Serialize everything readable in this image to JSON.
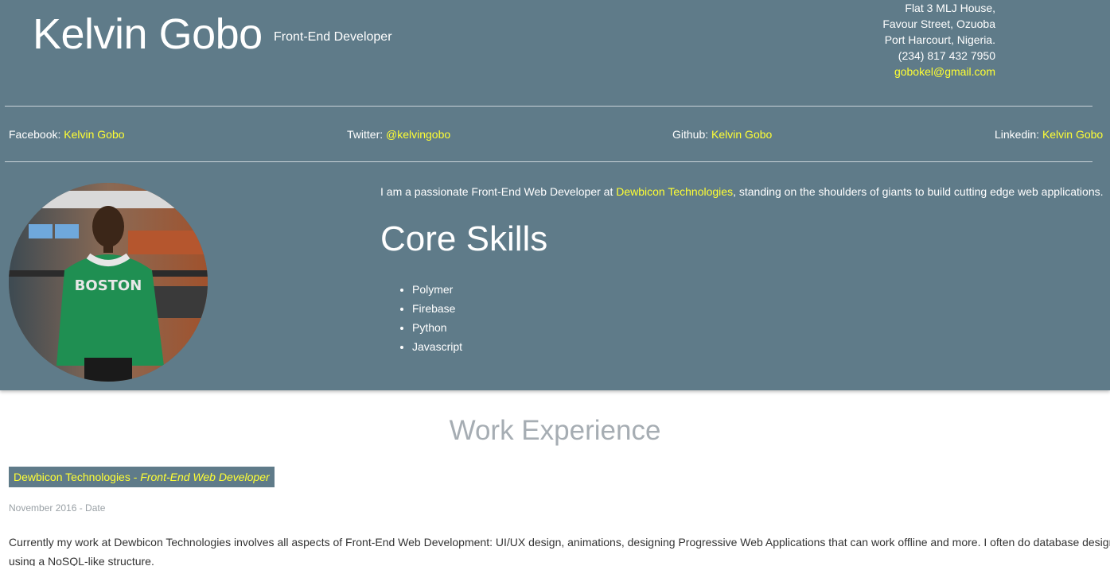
{
  "header": {
    "name": "Kelvin Gobo",
    "role": "Front-End Developer",
    "address": [
      "Flat 3 MLJ House,",
      "Favour Street, Ozuoba",
      "Port Harcourt, Nigeria."
    ],
    "phone": "(234) 817 432 7950",
    "email": "gobokel@gmail.com"
  },
  "social": [
    {
      "label": "Facebook:",
      "value": "Kelvin Gobo"
    },
    {
      "label": "Twitter:",
      "value": "@kelvingobo"
    },
    {
      "label": "Github:",
      "value": "Kelvin Gobo"
    },
    {
      "label": "Linkedin:",
      "value": "Kelvin Gobo"
    }
  ],
  "intro": {
    "before": "I am a passionate Front-End Web Developer at ",
    "company": "Dewbicon Technologies",
    "after": ", standing on the shoulders of giants to build cutting edge web applications."
  },
  "skills": {
    "title": "Core Skills",
    "items": [
      "Polymer",
      "Firebase",
      "Python",
      "Javascript"
    ]
  },
  "work": {
    "title": "Work Experience",
    "jobs": [
      {
        "company": "Dewbicon Technologies",
        "separator": " - ",
        "role": "Front-End Web Developer",
        "date": "November 2016 - Date",
        "description": "Currently my work at Dewbicon Technologies involves all aspects of Front-End Web Development: UI/UX design, animations, designing Progressive Web Applications that can work offline and more. I often do database design using a NoSQL-like structure."
      }
    ]
  },
  "colors": {
    "header_bg": "#5f7b89",
    "accent": "#ffff33",
    "muted": "#a6adb3"
  },
  "icons": {
    "avatar": "profile-photo"
  }
}
